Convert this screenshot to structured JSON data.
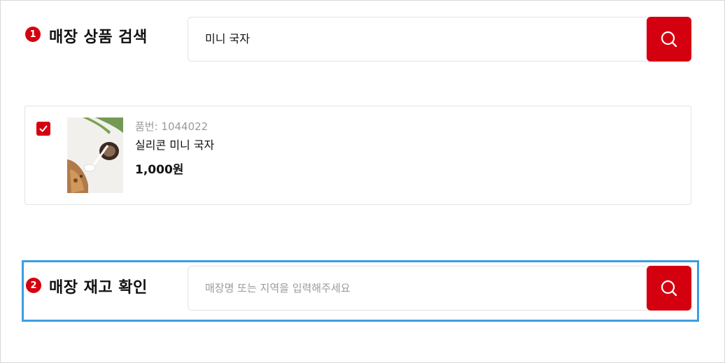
{
  "section1": {
    "step": "1",
    "title": "매장 상품 검색",
    "search_value": "미니 국자"
  },
  "product": {
    "checked": true,
    "code_label": "품번: 1044022",
    "name": "실리콘 미니 국자",
    "price": "1,000원"
  },
  "section2": {
    "step": "2",
    "title": "매장 재고 확인",
    "search_placeholder": "매장명 또는 지역을 입력해주세요"
  },
  "icons": {
    "search": "search-icon",
    "check": "check-icon"
  },
  "colors": {
    "accent": "#d5000f",
    "highlight": "#3b9ee0",
    "placeholder": "#9a9a9a"
  }
}
